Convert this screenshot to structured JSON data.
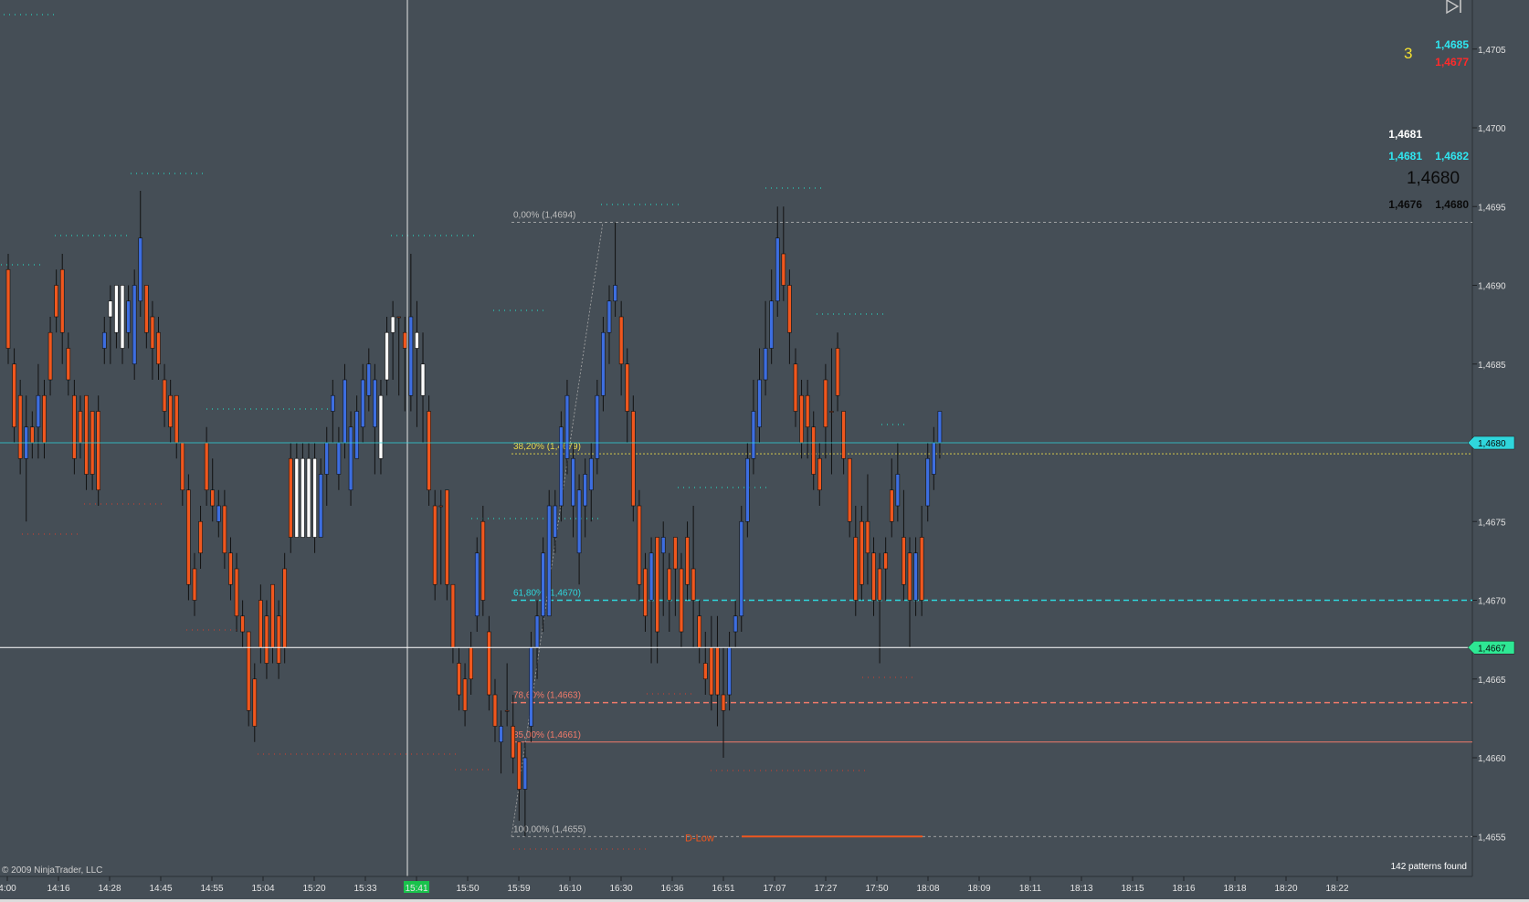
{
  "copyright": "© 2009 NinjaTrader, LLC",
  "patterns_found": "142 patterns found",
  "hud": {
    "count": "3",
    "ask": "1,4685",
    "bid": "1,4677",
    "row1": "1,4681",
    "row2a": "1,4681",
    "row2b": "1,4682",
    "big": "1,4680",
    "row4a": "1,4676",
    "row4b": "1,4680"
  },
  "colors": {
    "background": "#454e56",
    "up_candle": "#3d6ee0",
    "down_candle": "#f0571e",
    "doji_candle": "#ffffff",
    "cyan": "#2fd6dc",
    "yellow": "#e8d84a",
    "salmon": "#f07a6a",
    "green_tag": "#2ee894"
  },
  "chart_data": {
    "type": "candlestick",
    "instrument_axis": "price",
    "ylim": [
      1.46525,
      1.47125
    ],
    "y_ticks": [
      "1,4705",
      "1,4700",
      "1,4695",
      "1,4690",
      "1,4685",
      "1,4680",
      "1,4675",
      "1,4670",
      "1,4665",
      "1,4660",
      "1,4655"
    ],
    "y_tick_values": [
      1.4705,
      1.47,
      1.4695,
      1.469,
      1.4685,
      1.468,
      1.4675,
      1.467,
      1.4665,
      1.466,
      1.4655
    ],
    "x_ticks": [
      "4:00",
      "14:16",
      "14:28",
      "14:45",
      "14:55",
      "15:04",
      "15:20",
      "15:33",
      "15:41",
      "15:50",
      "15:59",
      "16:10",
      "16:30",
      "16:36",
      "16:51",
      "17:07",
      "17:27",
      "17:50",
      "18:08",
      "18:09",
      "18:11",
      "18:13",
      "18:15",
      "18:16",
      "18:18",
      "18:20",
      "18:22"
    ],
    "highlighted_x_tick": "15:41",
    "price_tags": [
      {
        "label": "1,4680",
        "value": 1.468,
        "color": "#2fd6dc"
      },
      {
        "label": "1,4667",
        "value": 1.4667,
        "color": "#2ee894"
      }
    ],
    "fibonacci": [
      {
        "label": "0,00% (1,4694)",
        "value": 1.4694,
        "color": "#bdbdbd"
      },
      {
        "label": "38,20% (1,4679)",
        "value": 1.46793,
        "color": "#e8d84a"
      },
      {
        "label": "61,80% (1,4670)",
        "value": 1.467,
        "color": "#2fd6dc"
      },
      {
        "label": "78,60% (1,4663)",
        "value": 1.46635,
        "color": "#f07a6a"
      },
      {
        "label": "85,00% (1,4661)",
        "value": 1.4661,
        "color": "#f07a6a"
      },
      {
        "label": "100,00% (1,4655)",
        "value": 1.4655,
        "color": "#bdbdbd"
      }
    ],
    "d_low_label": "D-Low",
    "d_low_value": 1.4655,
    "candles": [
      {
        "o": 1.4691,
        "h": 1.4692,
        "l": 1.4685,
        "c": 1.4686
      },
      {
        "o": 1.4685,
        "h": 1.4686,
        "l": 1.468,
        "c": 1.4681
      },
      {
        "o": 1.4683,
        "h": 1.4684,
        "l": 1.4678,
        "c": 1.4679
      },
      {
        "o": 1.4679,
        "h": 1.4683,
        "l": 1.4675,
        "c": 1.4681
      },
      {
        "o": 1.4681,
        "h": 1.4682,
        "l": 1.4679,
        "c": 1.468
      },
      {
        "o": 1.4681,
        "h": 1.4685,
        "l": 1.4679,
        "c": 1.4683
      },
      {
        "o": 1.4683,
        "h": 1.4684,
        "l": 1.4679,
        "c": 1.468
      },
      {
        "o": 1.4687,
        "h": 1.4688,
        "l": 1.4683,
        "c": 1.4684
      },
      {
        "o": 1.469,
        "h": 1.4691,
        "l": 1.4687,
        "c": 1.4688
      },
      {
        "o": 1.4691,
        "h": 1.4692,
        "l": 1.4685,
        "c": 1.4687
      },
      {
        "o": 1.4686,
        "h": 1.4687,
        "l": 1.4683,
        "c": 1.4684
      },
      {
        "o": 1.4683,
        "h": 1.4684,
        "l": 1.4678,
        "c": 1.4679
      },
      {
        "o": 1.4682,
        "h": 1.4683,
        "l": 1.4679,
        "c": 1.468
      },
      {
        "o": 1.4683,
        "h": 1.4683,
        "l": 1.4677,
        "c": 1.4678
      },
      {
        "o": 1.4682,
        "h": 1.4682,
        "l": 1.4677,
        "c": 1.4678
      },
      {
        "o": 1.4682,
        "h": 1.4683,
        "l": 1.4676,
        "c": 1.4677
      },
      {
        "o": 1.4686,
        "h": 1.4688,
        "l": 1.4685,
        "c": 1.4687
      },
      {
        "o": 1.4688,
        "h": 1.469,
        "l": 1.4685,
        "c": 1.4689
      },
      {
        "o": 1.4687,
        "h": 1.469,
        "l": 1.4686,
        "c": 1.469
      },
      {
        "o": 1.469,
        "h": 1.469,
        "l": 1.4685,
        "c": 1.4686
      },
      {
        "o": 1.4687,
        "h": 1.469,
        "l": 1.4686,
        "c": 1.4689
      },
      {
        "o": 1.4685,
        "h": 1.4691,
        "l": 1.4684,
        "c": 1.469
      },
      {
        "o": 1.4689,
        "h": 1.4696,
        "l": 1.4688,
        "c": 1.4693
      },
      {
        "o": 1.469,
        "h": 1.469,
        "l": 1.4686,
        "c": 1.4687
      },
      {
        "o": 1.4688,
        "h": 1.4689,
        "l": 1.4684,
        "c": 1.4686
      },
      {
        "o": 1.4687,
        "h": 1.4688,
        "l": 1.4684,
        "c": 1.4685
      },
      {
        "o": 1.4684,
        "h": 1.4685,
        "l": 1.4681,
        "c": 1.4682
      },
      {
        "o": 1.4683,
        "h": 1.4684,
        "l": 1.468,
        "c": 1.4681
      },
      {
        "o": 1.4683,
        "h": 1.4683,
        "l": 1.4679,
        "c": 1.468
      },
      {
        "o": 1.468,
        "h": 1.468,
        "l": 1.4676,
        "c": 1.4677
      },
      {
        "o": 1.4677,
        "h": 1.4678,
        "l": 1.467,
        "c": 1.4671
      },
      {
        "o": 1.4672,
        "h": 1.4673,
        "l": 1.4669,
        "c": 1.467
      },
      {
        "o": 1.4675,
        "h": 1.4676,
        "l": 1.4672,
        "c": 1.4673
      },
      {
        "o": 1.468,
        "h": 1.4681,
        "l": 1.4676,
        "c": 1.4677
      },
      {
        "o": 1.4677,
        "h": 1.4679,
        "l": 1.4675,
        "c": 1.4676
      },
      {
        "o": 1.4675,
        "h": 1.4677,
        "l": 1.4674,
        "c": 1.4676
      },
      {
        "o": 1.4676,
        "h": 1.4677,
        "l": 1.4672,
        "c": 1.4673
      },
      {
        "o": 1.4673,
        "h": 1.4674,
        "l": 1.467,
        "c": 1.4671
      },
      {
        "o": 1.4672,
        "h": 1.4673,
        "l": 1.4668,
        "c": 1.4669
      },
      {
        "o": 1.4669,
        "h": 1.467,
        "l": 1.4667,
        "c": 1.4668
      },
      {
        "o": 1.4668,
        "h": 1.4668,
        "l": 1.4662,
        "c": 1.4663
      },
      {
        "o": 1.4665,
        "h": 1.4666,
        "l": 1.4661,
        "c": 1.4662
      },
      {
        "o": 1.467,
        "h": 1.4671,
        "l": 1.4666,
        "c": 1.4667
      },
      {
        "o": 1.4669,
        "h": 1.467,
        "l": 1.4665,
        "c": 1.4666
      },
      {
        "o": 1.4671,
        "h": 1.4671,
        "l": 1.4666,
        "c": 1.4667
      },
      {
        "o": 1.4669,
        "h": 1.467,
        "l": 1.4665,
        "c": 1.4666
      },
      {
        "o": 1.4672,
        "h": 1.4673,
        "l": 1.4666,
        "c": 1.4667
      },
      {
        "o": 1.4679,
        "h": 1.468,
        "l": 1.4673,
        "c": 1.4674
      },
      {
        "o": 1.4674,
        "h": 1.468,
        "l": 1.4674,
        "c": 1.4679
      },
      {
        "o": 1.4674,
        "h": 1.468,
        "l": 1.4674,
        "c": 1.4679
      },
      {
        "o": 1.4674,
        "h": 1.468,
        "l": 1.4674,
        "c": 1.4679
      },
      {
        "o": 1.4674,
        "h": 1.468,
        "l": 1.4673,
        "c": 1.4679
      },
      {
        "o": 1.4674,
        "h": 1.4679,
        "l": 1.4674,
        "c": 1.4678
      },
      {
        "o": 1.4678,
        "h": 1.4681,
        "l": 1.4676,
        "c": 1.468
      },
      {
        "o": 1.4682,
        "h": 1.4684,
        "l": 1.468,
        "c": 1.4683
      },
      {
        "o": 1.4678,
        "h": 1.4681,
        "l": 1.4677,
        "c": 1.468
      },
      {
        "o": 1.468,
        "h": 1.4685,
        "l": 1.4679,
        "c": 1.4684
      },
      {
        "o": 1.4677,
        "h": 1.4682,
        "l": 1.4676,
        "c": 1.4681
      },
      {
        "o": 1.4679,
        "h": 1.4683,
        "l": 1.4679,
        "c": 1.4682
      },
      {
        "o": 1.4681,
        "h": 1.4685,
        "l": 1.468,
        "c": 1.4684
      },
      {
        "o": 1.4683,
        "h": 1.4686,
        "l": 1.4682,
        "c": 1.4685
      },
      {
        "o": 1.4681,
        "h": 1.4685,
        "l": 1.4678,
        "c": 1.4684
      },
      {
        "o": 1.4679,
        "h": 1.4684,
        "l": 1.4678,
        "c": 1.4683
      },
      {
        "o": 1.4684,
        "h": 1.4688,
        "l": 1.4683,
        "c": 1.4687
      },
      {
        "o": 1.4688,
        "h": 1.4689,
        "l": 1.4684,
        "c": 1.4687
      },
      {
        "o": 1.4688,
        "h": 1.4688,
        "l": 1.4683,
        "c": 1.4688
      },
      {
        "o": 1.4687,
        "h": 1.4688,
        "l": 1.4682,
        "c": 1.4686
      },
      {
        "o": 1.4683,
        "h": 1.4692,
        "l": 1.4682,
        "c": 1.4688
      },
      {
        "o": 1.4686,
        "h": 1.4689,
        "l": 1.4681,
        "c": 1.4687
      },
      {
        "o": 1.4685,
        "h": 1.4687,
        "l": 1.468,
        "c": 1.4683
      },
      {
        "o": 1.4682,
        "h": 1.4683,
        "l": 1.4676,
        "c": 1.4677
      },
      {
        "o": 1.4676,
        "h": 1.4677,
        "l": 1.467,
        "c": 1.4671
      },
      {
        "o": 1.4676,
        "h": 1.4677,
        "l": 1.4671,
        "c": 1.4676
      },
      {
        "o": 1.4677,
        "h": 1.4677,
        "l": 1.467,
        "c": 1.4671
      },
      {
        "o": 1.4671,
        "h": 1.4671,
        "l": 1.4666,
        "c": 1.4667
      },
      {
        "o": 1.4666,
        "h": 1.4667,
        "l": 1.4663,
        "c": 1.4664
      },
      {
        "o": 1.4665,
        "h": 1.4666,
        "l": 1.4662,
        "c": 1.4663
      },
      {
        "o": 1.4667,
        "h": 1.4668,
        "l": 1.4664,
        "c": 1.4665
      },
      {
        "o": 1.4669,
        "h": 1.4674,
        "l": 1.4668,
        "c": 1.4673
      },
      {
        "o": 1.4675,
        "h": 1.4676,
        "l": 1.4669,
        "c": 1.467
      },
      {
        "o": 1.4668,
        "h": 1.4669,
        "l": 1.4663,
        "c": 1.4664
      },
      {
        "o": 1.4664,
        "h": 1.4665,
        "l": 1.4661,
        "c": 1.4662
      },
      {
        "o": 1.4661,
        "h": 1.4663,
        "l": 1.4659,
        "c": 1.4662
      },
      {
        "o": 1.4663,
        "h": 1.4666,
        "l": 1.4662,
        "c": 1.4663
      },
      {
        "o": 1.4662,
        "h": 1.4664,
        "l": 1.4659,
        "c": 1.466
      },
      {
        "o": 1.4661,
        "h": 1.4661,
        "l": 1.4656,
        "c": 1.4658
      },
      {
        "o": 1.4658,
        "h": 1.4661,
        "l": 1.4655,
        "c": 1.466
      },
      {
        "o": 1.4662,
        "h": 1.4668,
        "l": 1.4661,
        "c": 1.4667
      },
      {
        "o": 1.4667,
        "h": 1.467,
        "l": 1.4665,
        "c": 1.4669
      },
      {
        "o": 1.4669,
        "h": 1.4674,
        "l": 1.4668,
        "c": 1.4673
      },
      {
        "o": 1.4669,
        "h": 1.4677,
        "l": 1.4669,
        "c": 1.4676
      },
      {
        "o": 1.4674,
        "h": 1.4677,
        "l": 1.4673,
        "c": 1.4676
      },
      {
        "o": 1.4676,
        "h": 1.4682,
        "l": 1.4675,
        "c": 1.4681
      },
      {
        "o": 1.4679,
        "h": 1.4684,
        "l": 1.4678,
        "c": 1.4683
      },
      {
        "o": 1.4676,
        "h": 1.468,
        "l": 1.4674,
        "c": 1.4679
      },
      {
        "o": 1.4673,
        "h": 1.4678,
        "l": 1.4671,
        "c": 1.4677
      },
      {
        "o": 1.4676,
        "h": 1.4679,
        "l": 1.4674,
        "c": 1.4678
      },
      {
        "o": 1.4677,
        "h": 1.468,
        "l": 1.4675,
        "c": 1.4679
      },
      {
        "o": 1.4679,
        "h": 1.4684,
        "l": 1.4678,
        "c": 1.4683
      },
      {
        "o": 1.4683,
        "h": 1.4688,
        "l": 1.4682,
        "c": 1.4687
      },
      {
        "o": 1.4687,
        "h": 1.469,
        "l": 1.4685,
        "c": 1.4689
      },
      {
        "o": 1.4689,
        "h": 1.4694,
        "l": 1.4688,
        "c": 1.469
      },
      {
        "o": 1.4688,
        "h": 1.4689,
        "l": 1.4683,
        "c": 1.4685
      },
      {
        "o": 1.4685,
        "h": 1.4686,
        "l": 1.468,
        "c": 1.4682
      },
      {
        "o": 1.4682,
        "h": 1.4683,
        "l": 1.4675,
        "c": 1.4676
      },
      {
        "o": 1.4676,
        "h": 1.4677,
        "l": 1.467,
        "c": 1.4671
      },
      {
        "o": 1.4672,
        "h": 1.4673,
        "l": 1.4668,
        "c": 1.4669
      },
      {
        "o": 1.467,
        "h": 1.4674,
        "l": 1.4666,
        "c": 1.4673
      },
      {
        "o": 1.4674,
        "h": 1.4674,
        "l": 1.4666,
        "c": 1.4668
      },
      {
        "o": 1.4673,
        "h": 1.4675,
        "l": 1.4669,
        "c": 1.4674
      },
      {
        "o": 1.4672,
        "h": 1.4673,
        "l": 1.4668,
        "c": 1.467
      },
      {
        "o": 1.4674,
        "h": 1.4674,
        "l": 1.4669,
        "c": 1.4672
      },
      {
        "o": 1.4672,
        "h": 1.4673,
        "l": 1.4667,
        "c": 1.4668
      },
      {
        "o": 1.4674,
        "h": 1.4675,
        "l": 1.467,
        "c": 1.4671
      },
      {
        "o": 1.4672,
        "h": 1.4676,
        "l": 1.4667,
        "c": 1.467
      },
      {
        "o": 1.4669,
        "h": 1.467,
        "l": 1.4666,
        "c": 1.4667
      },
      {
        "o": 1.4666,
        "h": 1.4668,
        "l": 1.4664,
        "c": 1.4665
      },
      {
        "o": 1.4667,
        "h": 1.4669,
        "l": 1.4663,
        "c": 1.4664
      },
      {
        "o": 1.4667,
        "h": 1.4669,
        "l": 1.4662,
        "c": 1.4664
      },
      {
        "o": 1.4664,
        "h": 1.4667,
        "l": 1.466,
        "c": 1.4663
      },
      {
        "o": 1.4664,
        "h": 1.4668,
        "l": 1.4663,
        "c": 1.4667
      },
      {
        "o": 1.4668,
        "h": 1.467,
        "l": 1.4667,
        "c": 1.4669
      },
      {
        "o": 1.4669,
        "h": 1.4676,
        "l": 1.4668,
        "c": 1.4675
      },
      {
        "o": 1.4675,
        "h": 1.468,
        "l": 1.4674,
        "c": 1.4679
      },
      {
        "o": 1.4679,
        "h": 1.4684,
        "l": 1.4678,
        "c": 1.4682
      },
      {
        "o": 1.4681,
        "h": 1.4686,
        "l": 1.468,
        "c": 1.4684
      },
      {
        "o": 1.4684,
        "h": 1.4689,
        "l": 1.4683,
        "c": 1.4686
      },
      {
        "o": 1.4686,
        "h": 1.4691,
        "l": 1.4685,
        "c": 1.4689
      },
      {
        "o": 1.4689,
        "h": 1.4695,
        "l": 1.4688,
        "c": 1.4693
      },
      {
        "o": 1.4692,
        "h": 1.4695,
        "l": 1.4689,
        "c": 1.469
      },
      {
        "o": 1.469,
        "h": 1.4691,
        "l": 1.4685,
        "c": 1.4687
      },
      {
        "o": 1.4685,
        "h": 1.4686,
        "l": 1.4681,
        "c": 1.4682
      },
      {
        "o": 1.4683,
        "h": 1.4684,
        "l": 1.4679,
        "c": 1.468
      },
      {
        "o": 1.4683,
        "h": 1.4684,
        "l": 1.4679,
        "c": 1.4681
      },
      {
        "o": 1.4681,
        "h": 1.4682,
        "l": 1.4677,
        "c": 1.4678
      },
      {
        "o": 1.4679,
        "h": 1.468,
        "l": 1.4676,
        "c": 1.4677
      },
      {
        "o": 1.4684,
        "h": 1.4685,
        "l": 1.4679,
        "c": 1.4681
      },
      {
        "o": 1.4682,
        "h": 1.4686,
        "l": 1.4678,
        "c": 1.4682
      },
      {
        "o": 1.4686,
        "h": 1.4687,
        "l": 1.4682,
        "c": 1.4683
      },
      {
        "o": 1.4682,
        "h": 1.4682,
        "l": 1.4678,
        "c": 1.4679
      },
      {
        "o": 1.4679,
        "h": 1.4679,
        "l": 1.4674,
        "c": 1.4675
      },
      {
        "o": 1.4674,
        "h": 1.4676,
        "l": 1.4669,
        "c": 1.467
      },
      {
        "o": 1.4675,
        "h": 1.4676,
        "l": 1.467,
        "c": 1.4671
      },
      {
        "o": 1.4675,
        "h": 1.4678,
        "l": 1.4671,
        "c": 1.4673
      },
      {
        "o": 1.4673,
        "h": 1.4674,
        "l": 1.4669,
        "c": 1.467
      },
      {
        "o": 1.4672,
        "h": 1.4673,
        "l": 1.4666,
        "c": 1.467
      },
      {
        "o": 1.4673,
        "h": 1.4674,
        "l": 1.467,
        "c": 1.4672
      },
      {
        "o": 1.4677,
        "h": 1.4679,
        "l": 1.4674,
        "c": 1.4675
      },
      {
        "o": 1.4676,
        "h": 1.468,
        "l": 1.4675,
        "c": 1.4678
      },
      {
        "o": 1.4674,
        "h": 1.4677,
        "l": 1.467,
        "c": 1.4671
      },
      {
        "o": 1.4673,
        "h": 1.4674,
        "l": 1.4667,
        "c": 1.467
      },
      {
        "o": 1.467,
        "h": 1.4674,
        "l": 1.4669,
        "c": 1.4673
      },
      {
        "o": 1.4674,
        "h": 1.4676,
        "l": 1.4669,
        "c": 1.467
      },
      {
        "o": 1.4676,
        "h": 1.468,
        "l": 1.4675,
        "c": 1.4679
      },
      {
        "o": 1.4678,
        "h": 1.4681,
        "l": 1.4677,
        "c": 1.468
      },
      {
        "o": 1.468,
        "h": 1.4682,
        "l": 1.4679,
        "c": 1.4682
      }
    ]
  }
}
